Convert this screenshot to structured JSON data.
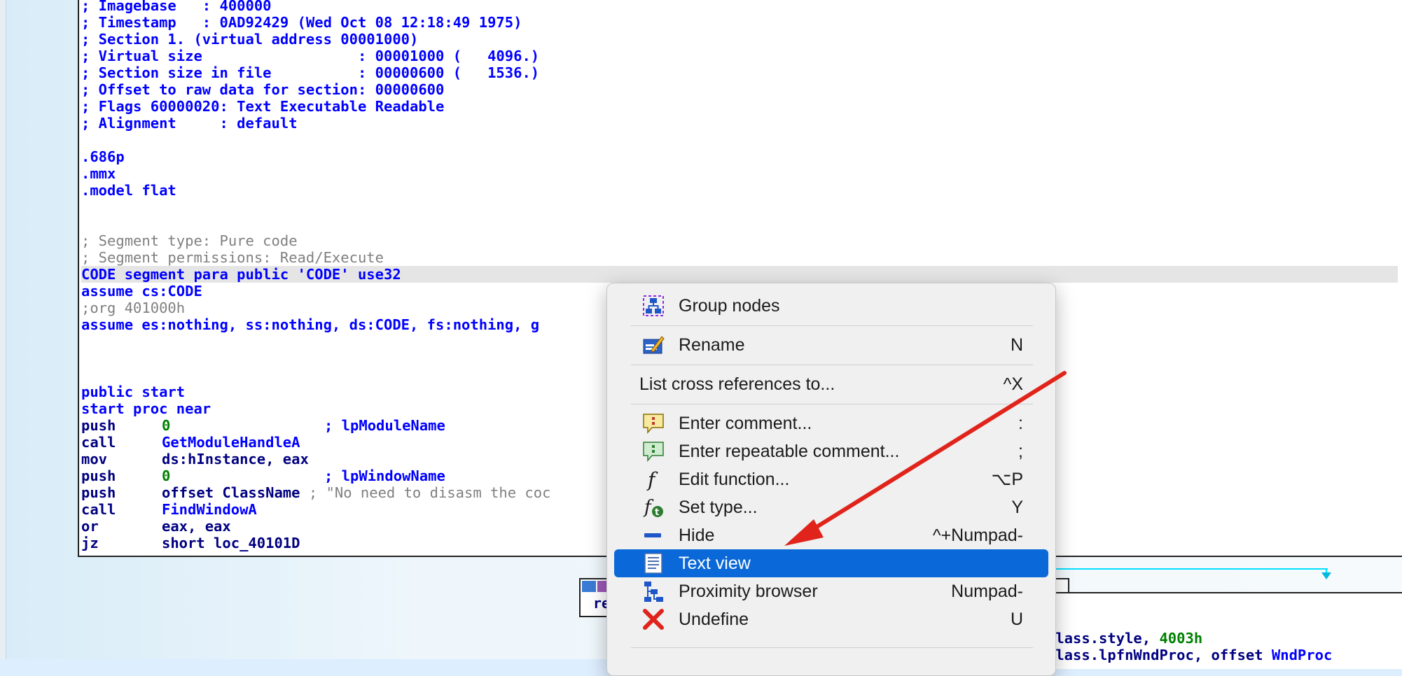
{
  "code_block": {
    "lines": [
      "; Imagebase   : 400000",
      "; Timestamp   : 0AD92429 (Wed Oct 08 12:18:49 1975)",
      "; Section 1. (virtual address 00001000)",
      "; Virtual size                  : 00001000 (   4096.)",
      "; Section size in file          : 00000600 (   1536.)",
      "; Offset to raw data for section: 00000600",
      "; Flags 60000020: Text Executable Readable",
      "; Alignment     : default",
      "",
      ".686p",
      ".mmx",
      ".model flat",
      "",
      "",
      "; Segment type: Pure code",
      "; Segment permissions: Read/Execute",
      "CODE segment para public 'CODE' use32",
      "assume cs:CODE",
      ";org 401000h",
      "assume es:nothing, ss:nothing, ds:CODE, fs:nothing, g",
      "",
      "",
      "",
      "public start",
      "start proc near"
    ],
    "instructions": [
      {
        "mnem": "push",
        "arg": "0",
        "comment": "; lpModuleName"
      },
      {
        "mnem": "call",
        "arg": "GetModuleHandleA",
        "comment": ""
      },
      {
        "mnem": "mov",
        "arg": "ds:hInstance, eax",
        "comment": ""
      },
      {
        "mnem": "push",
        "arg": "0",
        "comment": "; lpWindowName"
      },
      {
        "mnem": "push",
        "arg": "offset ClassName",
        "comment": "; \"No need to disasm the coc"
      },
      {
        "mnem": "call",
        "arg": "FindWindowA",
        "comment": ""
      },
      {
        "mnem": "or",
        "arg": "eax, eax",
        "comment": ""
      },
      {
        "mnem": "jz",
        "arg": "short loc_40101D",
        "comment": ""
      }
    ]
  },
  "lower_node": {
    "text": "re"
  },
  "right_node": {
    "line1_prefix": "Class.style, ",
    "line1_value": "4003h",
    "line2_prefix": "Class.lpfnWndProc, offset ",
    "line2_value": "WndProc"
  },
  "context_menu": {
    "items": [
      {
        "label": "Group nodes",
        "shortcut": "",
        "icon": "group-nodes-icon"
      },
      {
        "label": "Rename",
        "shortcut": "N",
        "icon": "rename-icon"
      },
      {
        "label": "List cross references to...",
        "shortcut": "^X",
        "icon": ""
      },
      {
        "label": "Enter comment...",
        "shortcut": ":",
        "icon": "comment-icon"
      },
      {
        "label": "Enter repeatable comment...",
        "shortcut": ";",
        "icon": "repeatable-comment-icon"
      },
      {
        "label": "Edit function...",
        "shortcut": "⌥P",
        "icon": "function-icon"
      },
      {
        "label": "Set type...",
        "shortcut": "Y",
        "icon": "set-type-icon"
      },
      {
        "label": "Hide",
        "shortcut": "^+Numpad-",
        "icon": "hide-icon"
      },
      {
        "label": "Text view",
        "shortcut": "",
        "icon": "text-view-icon"
      },
      {
        "label": "Proximity browser",
        "shortcut": "Numpad-",
        "icon": "proximity-browser-icon"
      },
      {
        "label": "Undefine",
        "shortcut": "U",
        "icon": "undefine-icon"
      }
    ],
    "highlighted": "Text view"
  },
  "colors": {
    "code_blue": "#0000ff",
    "comment_gray": "#808080",
    "constant_green": "#008000",
    "menu_highlight": "#0a68d8",
    "annotation_arrow": "#e0241b"
  }
}
